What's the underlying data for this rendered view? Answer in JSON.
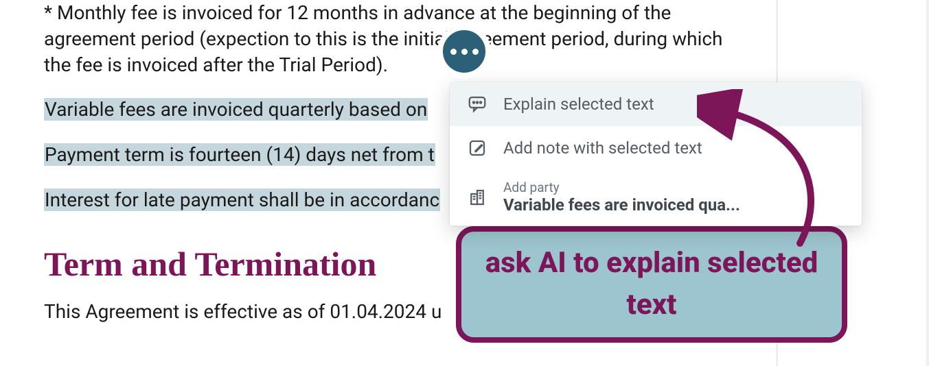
{
  "document": {
    "footnote": "* Monthly fee is invoiced for 12 months in advance at the beginning of the agreement period (expection to this is the initial agreement period, during which the fee is invoiced after the Trial Period).",
    "selected": {
      "line1": "Variable fees are invoiced quarterly based on",
      "line2": "Payment term is fourteen (14) days net from t",
      "line3": "Interest for late payment shall be in accordanc"
    },
    "heading": "Term and Termination",
    "after_heading": "This Agreement is effective as of 01.04.2024 u"
  },
  "popup": {
    "explain": "Explain selected text",
    "add_note": "Add note with selected text",
    "add_party_label": "Add party",
    "add_party_value": "Variable fees are invoiced qua..."
  },
  "callout": "ask AI to explain selected text"
}
